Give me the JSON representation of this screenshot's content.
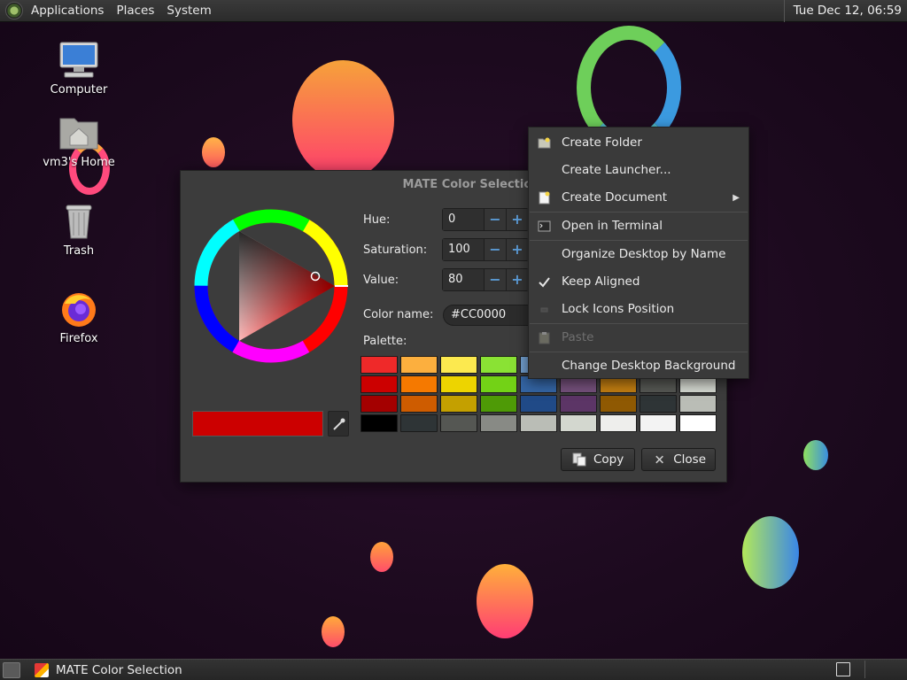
{
  "top_panel": {
    "menus": [
      "Applications",
      "Places",
      "System"
    ],
    "clock": "Tue Dec 12, 06:59"
  },
  "desktop_icons": [
    {
      "label": "Computer",
      "icon": "computer-icon"
    },
    {
      "label": "vm3's Home",
      "icon": "home-folder-icon"
    },
    {
      "label": "Trash",
      "icon": "trash-icon"
    },
    {
      "label": "Firefox",
      "icon": "firefox-icon"
    }
  ],
  "color_dialog": {
    "title": "MATE Color Selection",
    "hue_label": "Hue:",
    "hue_value": "0",
    "saturation_label": "Saturation:",
    "saturation_value": "100",
    "value_label": "Value:",
    "value_value": "80",
    "color_name_label": "Color name:",
    "color_name_value": "#CC0000",
    "palette_label": "Palette:",
    "current_color": "#CC0000",
    "palette": [
      "#ef2929",
      "#fcaf3e",
      "#fce94f",
      "#8ae234",
      "#729fcf",
      "#ad7fa8",
      "#e9b96e",
      "#888a85",
      "#eeeeec",
      "#cc0000",
      "#f57900",
      "#edd400",
      "#73d216",
      "#3465a4",
      "#75507b",
      "#c17d11",
      "#555753",
      "#d3d7cf",
      "#a40000",
      "#ce5c00",
      "#c4a000",
      "#4e9a06",
      "#204a87",
      "#5c3566",
      "#8f5902",
      "#2e3436",
      "#babdb6",
      "#000000",
      "#2e3436",
      "#555753",
      "#888a85",
      "#babdb6",
      "#d3d7cf",
      "#eeeeec",
      "#f3f3f3",
      "#ffffff"
    ],
    "copy_label": "Copy",
    "close_label": "Close"
  },
  "context_menu": {
    "items": [
      {
        "label": "Create Folder",
        "icon": "folder-new-icon",
        "enabled": true
      },
      {
        "label": "Create Launcher...",
        "icon": "",
        "enabled": true
      },
      {
        "label": "Create Document",
        "icon": "document-new-icon",
        "enabled": true,
        "submenu": true
      },
      {
        "label": "Open in Terminal",
        "icon": "terminal-icon",
        "enabled": true
      },
      {
        "label": "Organize Desktop by Name",
        "icon": "",
        "enabled": true
      },
      {
        "label": "Keep Aligned",
        "icon": "checkmark-icon",
        "enabled": true,
        "checked": true
      },
      {
        "label": "Lock Icons Position",
        "icon": "checkbox-icon",
        "enabled": true
      },
      {
        "label": "Paste",
        "icon": "paste-icon",
        "enabled": false
      },
      {
        "label": "Change Desktop Background",
        "icon": "",
        "enabled": true
      }
    ]
  },
  "taskbar": {
    "task_label": "MATE Color Selection"
  }
}
